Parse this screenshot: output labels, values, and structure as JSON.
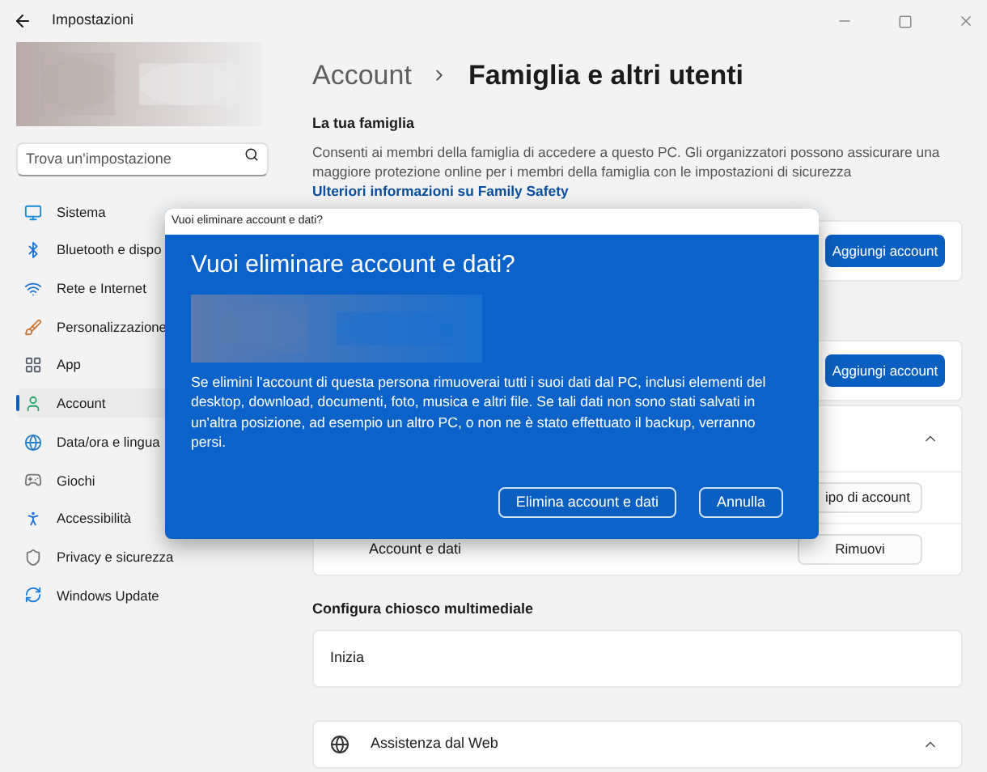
{
  "window": {
    "title": "Impostazioni"
  },
  "search": {
    "placeholder": "Trova un'impostazione"
  },
  "sidebar": {
    "items": [
      {
        "label": "Sistema",
        "selected": false
      },
      {
        "label": "Bluetooth e dispo",
        "selected": false
      },
      {
        "label": "Rete e Internet",
        "selected": false
      },
      {
        "label": "Personalizzazione",
        "selected": false
      },
      {
        "label": "App",
        "selected": false
      },
      {
        "label": "Account",
        "selected": true
      },
      {
        "label": "Data/ora e lingua",
        "selected": false
      },
      {
        "label": "Giochi",
        "selected": false
      },
      {
        "label": "Accessibilità",
        "selected": false
      },
      {
        "label": "Privacy e sicurezza",
        "selected": false
      },
      {
        "label": "Windows Update",
        "selected": false
      }
    ]
  },
  "breadcrumb": {
    "parent": "Account",
    "current": "Famiglia e altri utenti"
  },
  "family": {
    "heading": "La tua famiglia",
    "description": "Consenti ai membri della famiglia di accedere a questo PC. Gli organizzatori possono assicurare una maggiore protezione online per i membri della famiglia con le impostazioni di sicurezza",
    "link": "Ulteriori informazioni su Family Safety",
    "button": "Aggiungi account"
  },
  "other_users": {
    "button": "Aggiungi account",
    "expanded": true,
    "rows": [
      {
        "button": "ipo di account"
      },
      {
        "label": "Account e dati",
        "button": "Rimuovi"
      }
    ]
  },
  "kiosk": {
    "heading": "Configura chiosco multimediale",
    "card": "Inizia"
  },
  "help": {
    "label": "Assistenza dal Web",
    "expanded": true
  },
  "dialog": {
    "window_title": "Vuoi eliminare account e dati?",
    "title": "Vuoi eliminare account e dati?",
    "message": "Se elimini l'account di questa persona rimuoverai tutti i suoi dati dal PC, inclusi elementi del desktop, download, documenti, foto, musica e altri file. Se tali dati non sono stati salvati in un'altra posizione, ad esempio un altro PC, o non ne è stato effettuato il backup, verranno persi.",
    "buttons": [
      "Elimina account e dati",
      "Annulla"
    ]
  }
}
